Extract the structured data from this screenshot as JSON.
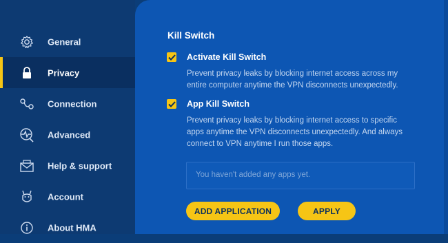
{
  "sidebar": {
    "items": [
      {
        "label": "General",
        "icon": "gear-icon"
      },
      {
        "label": "Privacy",
        "icon": "lock-icon",
        "active": true
      },
      {
        "label": "Connection",
        "icon": "connection-icon"
      },
      {
        "label": "Advanced",
        "icon": "advanced-icon"
      },
      {
        "label": "Help & support",
        "icon": "envelope-icon"
      },
      {
        "label": "Account",
        "icon": "donkey-icon"
      },
      {
        "label": "About HMA",
        "icon": "info-icon"
      }
    ]
  },
  "main": {
    "section_title": "Kill Switch",
    "options": [
      {
        "label": "Activate Kill Switch",
        "checked": true,
        "description_lines": [
          "Prevent privacy leaks by blocking internet access across my",
          "entire computer anytime the VPN disconnects unexpectedly."
        ]
      },
      {
        "label": "App Kill Switch",
        "checked": true,
        "description_lines": [
          "Prevent privacy leaks by blocking internet access to specific",
          "apps anytime the VPN disconnects unexpectedly. And always",
          "connect to VPN anytime I run those apps."
        ]
      }
    ],
    "apps_placeholder": "You haven't added any apps yet.",
    "add_button": "ADD APPLICATION",
    "apply_button": "APPLY"
  },
  "colors": {
    "accent": "#f6c515",
    "sidebar_bg": "#0d3a72",
    "panel_bg": "#0d56b3"
  }
}
